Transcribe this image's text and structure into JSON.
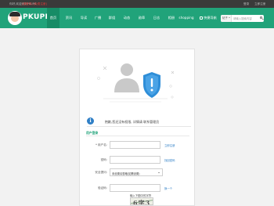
{
  "topbar": {
    "left_text": "你好,欢迎来到PKUPK",
    "link_text": "[请登录] [免费注册]",
    "right_login": "登录",
    "right_register": "立即注册"
  },
  "nav": {
    "logo_text": "PKUPK",
    "items": [
      {
        "label": "首页",
        "active": true
      },
      {
        "label": "资讯"
      },
      {
        "label": "导读"
      },
      {
        "label": "广播"
      },
      {
        "label": "群组"
      },
      {
        "label": "动态"
      },
      {
        "label": "勋章"
      },
      {
        "label": "日志"
      },
      {
        "label": "相册"
      },
      {
        "label": "shopping"
      }
    ],
    "quick_nav": "快捷导航",
    "search": {
      "scope": "帖子",
      "placeholder": "请输入搜索内容"
    }
  },
  "notice": {
    "text": "抱歉,您还没有权限, 详情请 联系管理员"
  },
  "form": {
    "section_title": "用户登录",
    "username_label": "* 用户名:",
    "username_hint": "立即注册",
    "password_label": "密码:",
    "password_hint": "找回密码",
    "question_label": "安全提问:",
    "question_value": "未设置请忽略(如需设置)",
    "captcha_label": "验证码:",
    "captcha_hint": "换一个",
    "captcha_tip": "输入下图中的字符",
    "captcha_code": "6字3"
  },
  "colors": {
    "brand_green": "#21a37a",
    "topbar_bg": "#3a3a3a",
    "info_blue": "#2f7fc6",
    "shield_blue": "#2f8ed8"
  }
}
